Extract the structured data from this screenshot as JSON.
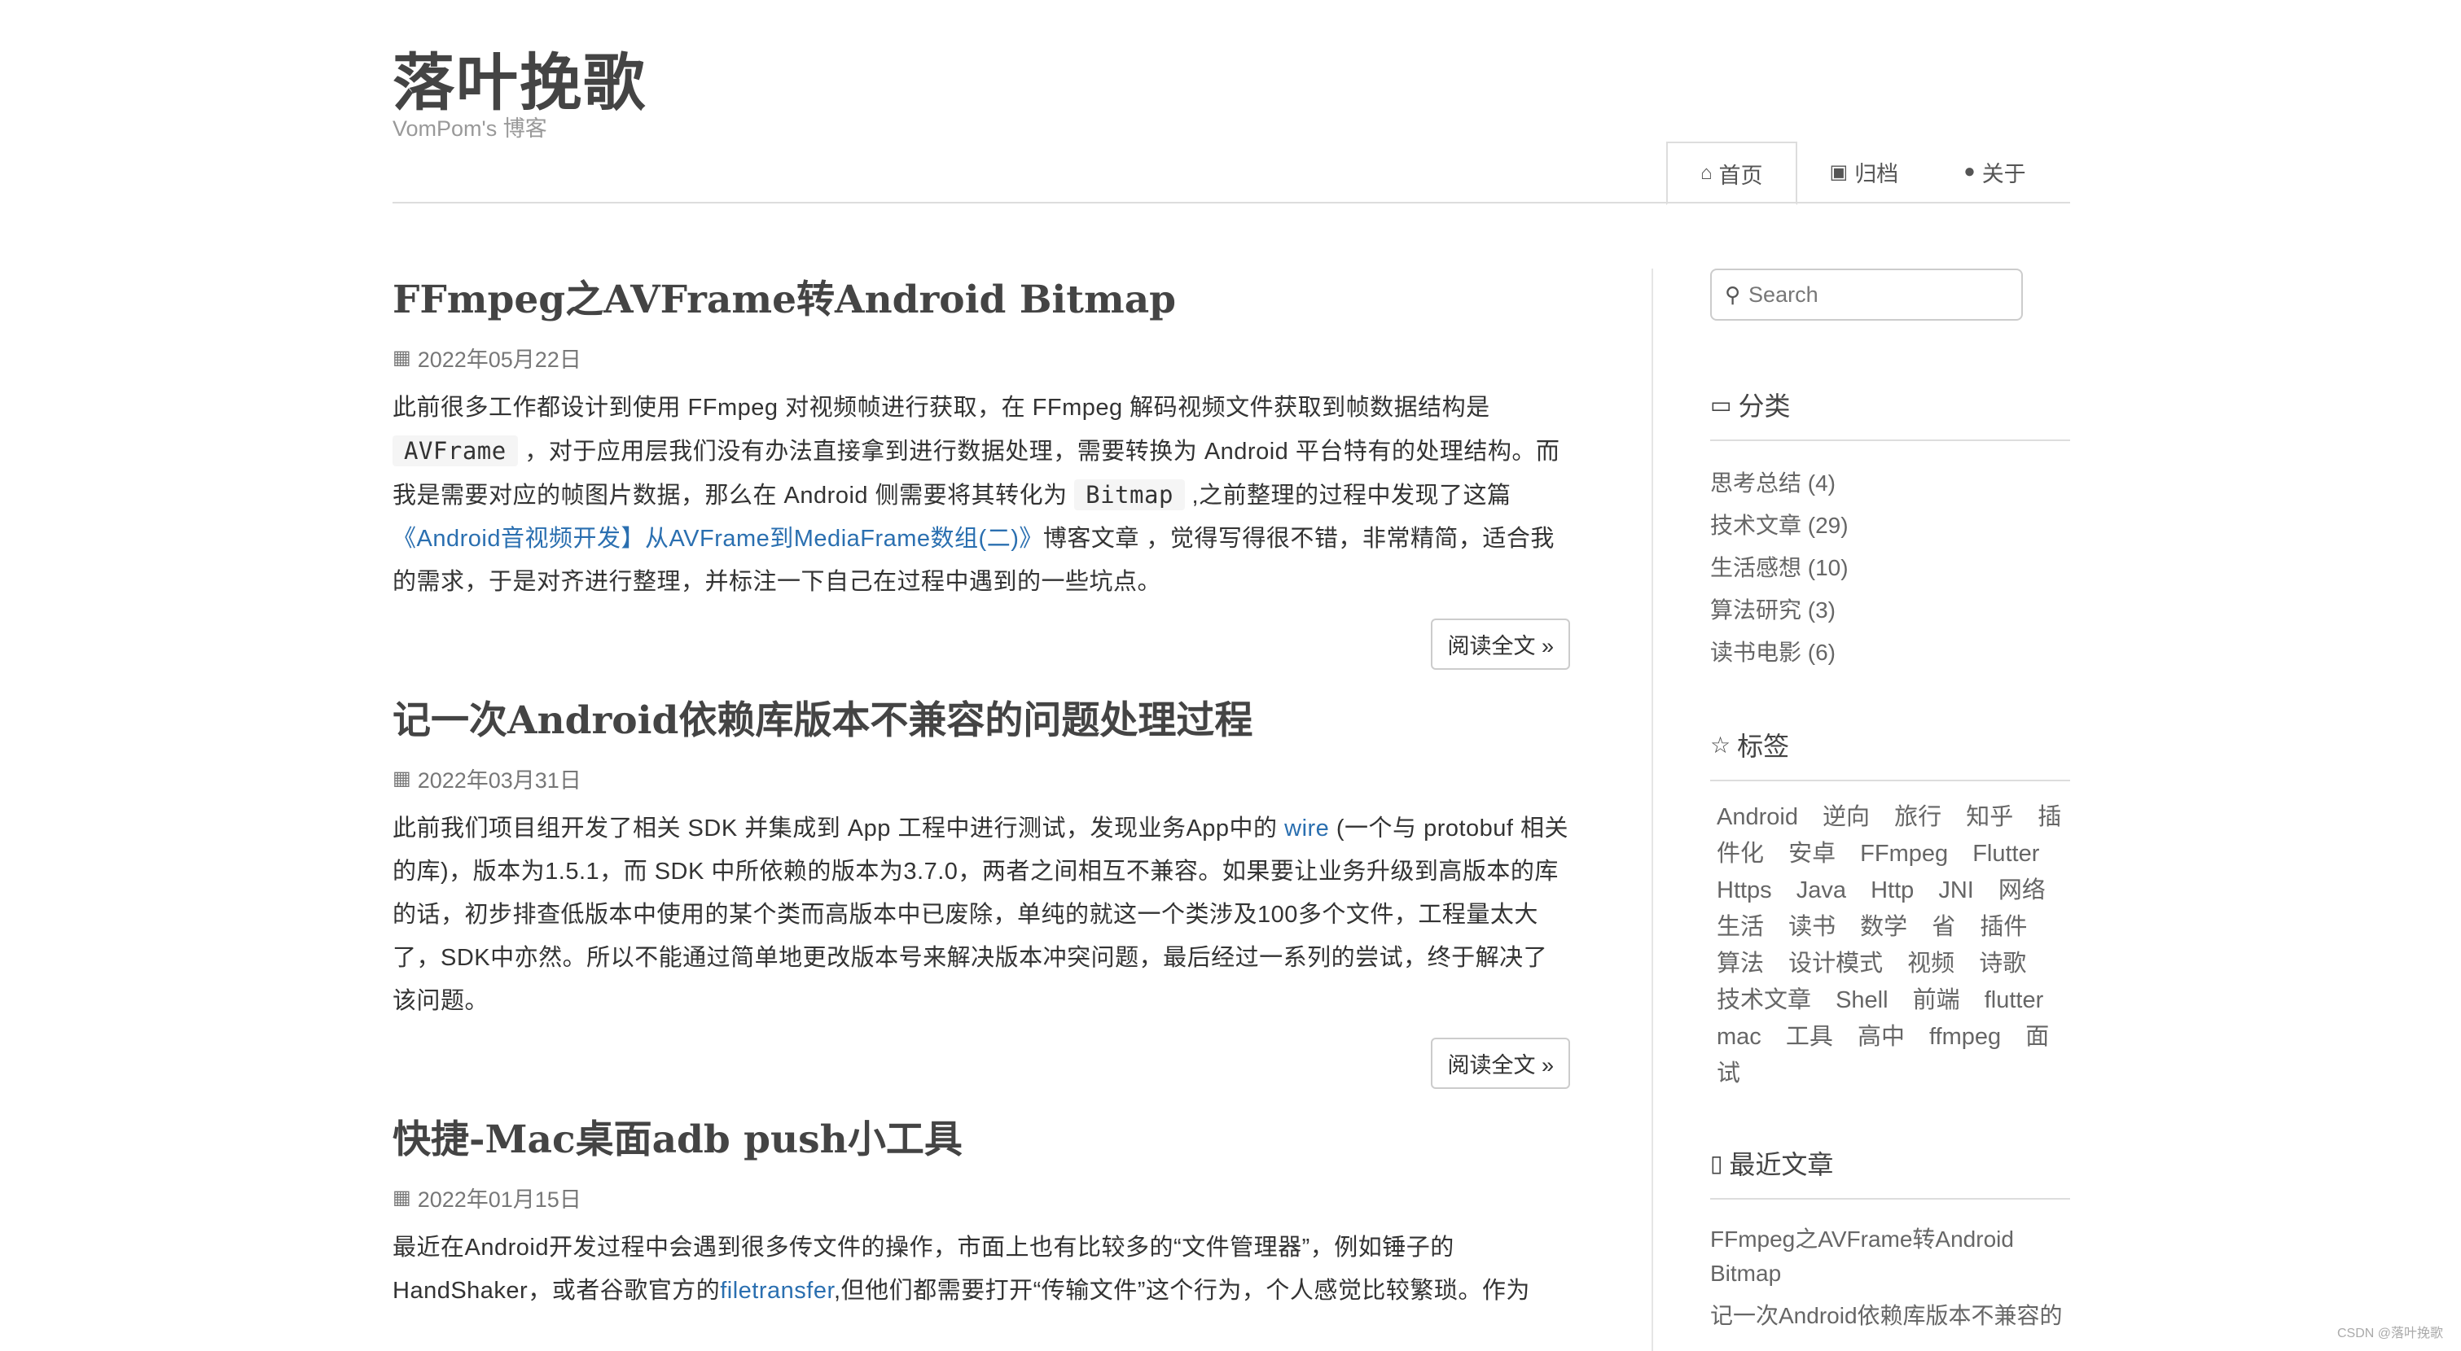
{
  "site": {
    "title": "落叶挽歌",
    "subtitle": "VomPom's 博客"
  },
  "nav": [
    {
      "icon": "⌂",
      "label": "首页"
    },
    {
      "icon": "▣",
      "label": "归档"
    },
    {
      "icon": "●",
      "label": "关于"
    }
  ],
  "posts": [
    {
      "title": "FFmpeg之AVFrame转Android Bitmap",
      "date": "2022年05月22日",
      "p1": "此前很多工作都设计到使用 FFmpeg 对视频帧进行获取，在 FFmpeg 解码视频文件获取到帧数据结构是 ",
      "code1": "AVFrame",
      "p2": " ，对于应用层我们没有办法直接拿到进行数据处理，需要转换为 Android 平台特有的处理结构。而我是需要对应的帧图片数据，那么在 Android 侧需要将其转化为 ",
      "code2": "Bitmap",
      "p3": " ,之前整理的过程中发现了这篇",
      "link": "《Android音视频开发】从AVFrame到MediaFrame数组(二)》",
      "p4": "博客文章 ，觉得写得很不错，非常精简，适合我的需求，于是对齐进行整理，并标注一下自己在过程中遇到的一些坑点。",
      "readmore": "阅读全文 »"
    },
    {
      "title": "记一次Android依赖库版本不兼容的问题处理过程",
      "date": "2022年03月31日",
      "p1": "此前我们项目组开发了相关 SDK 并集成到 App 工程中进行测试，发现业务App中的 ",
      "link": "wire",
      "p2": " (一个与 protobuf 相关的库)，版本为1.5.1，而 SDK 中所依赖的版本为3.7.0，两者之间相互不兼容。如果要让业务升级到高版本的库的话，初步排查低版本中使用的某个类而高版本中已废除，单纯的就这一个类涉及100多个文件，工程量太大了，SDK中亦然。所以不能通过简单地更改版本号来解决版本冲突问题，最后经过一系列的尝试，终于解决了该问题。",
      "readmore": "阅读全文 »"
    },
    {
      "title": "快捷-Mac桌面adb push小工具",
      "date": "2022年01月15日",
      "p1": "最近在Android开发过程中会遇到很多传文件的操作，市面上也有比较多的“文件管理器”，例如锤子的HandShaker，或者谷歌官方的",
      "link": "filetransfer",
      "p2": ",但他们都需要打开“传输文件”这个行为，个人感觉比较繁琐。作为"
    }
  ],
  "sidebar": {
    "search_placeholder": "Search",
    "categories_title": "分类",
    "categories": [
      "思考总结 (4)",
      "技术文章 (29)",
      "生活感想 (10)",
      "算法研究 (3)",
      "读书电影 (6)"
    ],
    "tags_title": "标签",
    "tags": [
      "Android",
      "逆向",
      "旅行",
      "知乎",
      "插件化",
      "安卓",
      "FFmpeg",
      "Flutter",
      "Https",
      "Java",
      "Http",
      "JNI",
      "网络",
      "生活",
      "读书",
      "数学",
      "省",
      "插件",
      "算法",
      "设计模式",
      "视频",
      "诗歌",
      "技术文章",
      "Shell",
      "前端",
      "flutter",
      "mac",
      "工具",
      "高中",
      "ffmpeg",
      "面试"
    ],
    "recent_title": "最近文章",
    "recent": [
      "FFmpeg之AVFrame转Android Bitmap",
      "记一次Android依赖库版本不兼容的"
    ]
  },
  "watermark": "CSDN @落叶挽歌"
}
